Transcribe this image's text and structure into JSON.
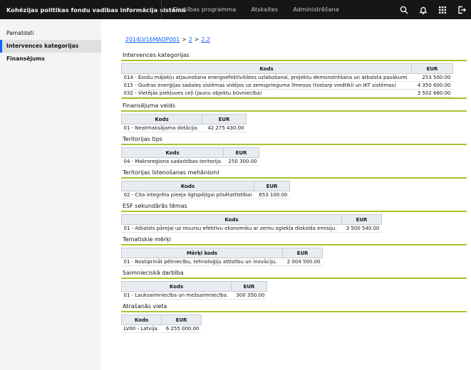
{
  "header": {
    "title": "Kohēzijas politikas fondu vadības informācija sistēma",
    "nav": [
      "Darbības programma",
      "Atskaites",
      "Administrēšana"
    ],
    "icons": [
      "search-icon",
      "notification-icon",
      "app-switcher-icon",
      "logout-icon"
    ]
  },
  "sidebar": {
    "items": [
      {
        "label": "Pamatdati"
      },
      {
        "label": "Intervences kategorijas"
      },
      {
        "label": "Finansējums"
      }
    ]
  },
  "breadcrumb": {
    "items": [
      "2014LV16MAOP001",
      "2",
      "2.2"
    ],
    "separator": ">"
  },
  "sections": [
    {
      "title": "Intervences kategorijas",
      "headers": [
        "Kods",
        "EUR"
      ],
      "rows": [
        [
          "014 - Esošu mājokļu atjaunošana energoefektivitātes uzlabošanai, projektu demonstrēšana un atbalsta pasākumi",
          "253 500.00"
        ],
        [
          "015 - Gudras enerģijas sadales sistēmas vidējos uz zemsprieguma līmeņos (tostarp viedtīkli un IKT sistēmas)",
          "4 350 600.00"
        ],
        [
          "032 - Vietējās piekļuves ceļi (jaunu objektu būvniecība)",
          "3 502 660.00"
        ]
      ]
    },
    {
      "title": "Finansējuma veids",
      "headers": [
        "Kods",
        "EUR"
      ],
      "rows": [
        [
          "01 - Neatmaksājama dotācija.",
          "42 275 430.00"
        ]
      ]
    },
    {
      "title": "Teritorijas tips",
      "headers": [
        "Kods",
        "EUR"
      ],
      "rows": [
        [
          "04 - Makroreģiona sadarbības teritorija",
          "250 300.00"
        ]
      ]
    },
    {
      "title": "Teritorijas īstenošanas mehānismi",
      "headers": [
        "Kods",
        "EUR"
      ],
      "rows": [
        [
          "02 - Cita integrēta pieeja ilgtspējīgai pilsētattīstībai",
          "653 100.00"
        ]
      ]
    },
    {
      "title": "ESF sekundārās tēmas",
      "headers": [
        "Kods",
        "EUR"
      ],
      "rows": [
        [
          "01 - Atbalsts pārejai uz resursu efektīvu ekonomiku ar zemu oglekļa dioksīda emisiju.",
          "3 500 540.00"
        ]
      ]
    },
    {
      "title": "Tematiskie mērķi",
      "headers": [
        "Mērķi kods",
        "EUR"
      ],
      "rows": [
        [
          "01 - Nostiprināt pētniecību, tehnoloģiju attīstību un inovāciju.",
          "2 004 500.00"
        ]
      ]
    },
    {
      "title": "Saimnieciskā darbība",
      "headers": [
        "Kods",
        "EUR"
      ],
      "rows": [
        [
          "01 - Lauksaimniecība un mežsaimniecība.",
          "300 350.00"
        ]
      ]
    },
    {
      "title": "Atrašanās vieta",
      "headers": [
        "Kods",
        "EUR"
      ],
      "rows": [
        [
          "LV00 - Latvija.",
          "6 255 000.00"
        ]
      ]
    }
  ],
  "colors": {
    "header_bg": "#161616",
    "accent_rule": "#a6c431",
    "link": "#0f62fe",
    "table_header_bg": "#e8ecf1"
  }
}
